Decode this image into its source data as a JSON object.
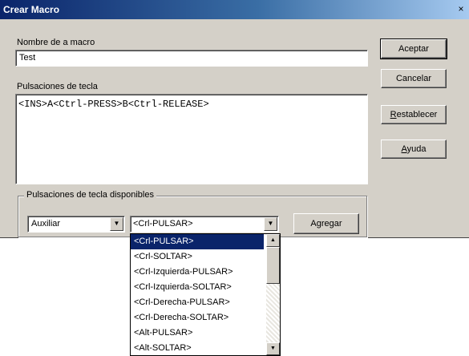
{
  "window": {
    "title": "Crear Macro",
    "close_glyph": "×"
  },
  "form": {
    "macro_name_label": "Nombre de a macro",
    "macro_name_value": "Test",
    "keystrokes_label": "Pulsaciones de tecla",
    "keystrokes_value": "<INS>A<Ctrl-PRESS>B<Ctrl-RELEASE>"
  },
  "buttons": {
    "accept": "Aceptar",
    "cancel": "Cancelar",
    "reset_mnemonic": "R",
    "reset_rest": "establecer",
    "help_mnemonic": "A",
    "help_rest": "yuda"
  },
  "available": {
    "group_label": "Pulsaciones de tecla disponibles",
    "category_value": "Auxiliar",
    "key_value": "<Crl-PULSAR>",
    "add_mnemonic": "g",
    "add_before": "A",
    "add_after": "regar"
  },
  "dropdown": {
    "items": [
      "<Crl-PULSAR>",
      "<Crl-SOLTAR>",
      "<Crl-Izquierda-PULSAR>",
      "<Crl-Izquierda-SOLTAR>",
      "<Crl-Derecha-PULSAR>",
      "<Crl-Derecha-SOLTAR>",
      "<Alt-PULSAR>",
      "<Alt-SOLTAR>"
    ],
    "selected_index": 0
  },
  "icons": {
    "close": "close-icon",
    "combo_arrow": "chevron-down-icon",
    "scroll_up": "chevron-up-icon",
    "scroll_down": "chevron-down-icon"
  },
  "colors": {
    "title_bar": "#0a246a",
    "dialog_face": "#d4d0c8",
    "selection": "#0a246a"
  }
}
